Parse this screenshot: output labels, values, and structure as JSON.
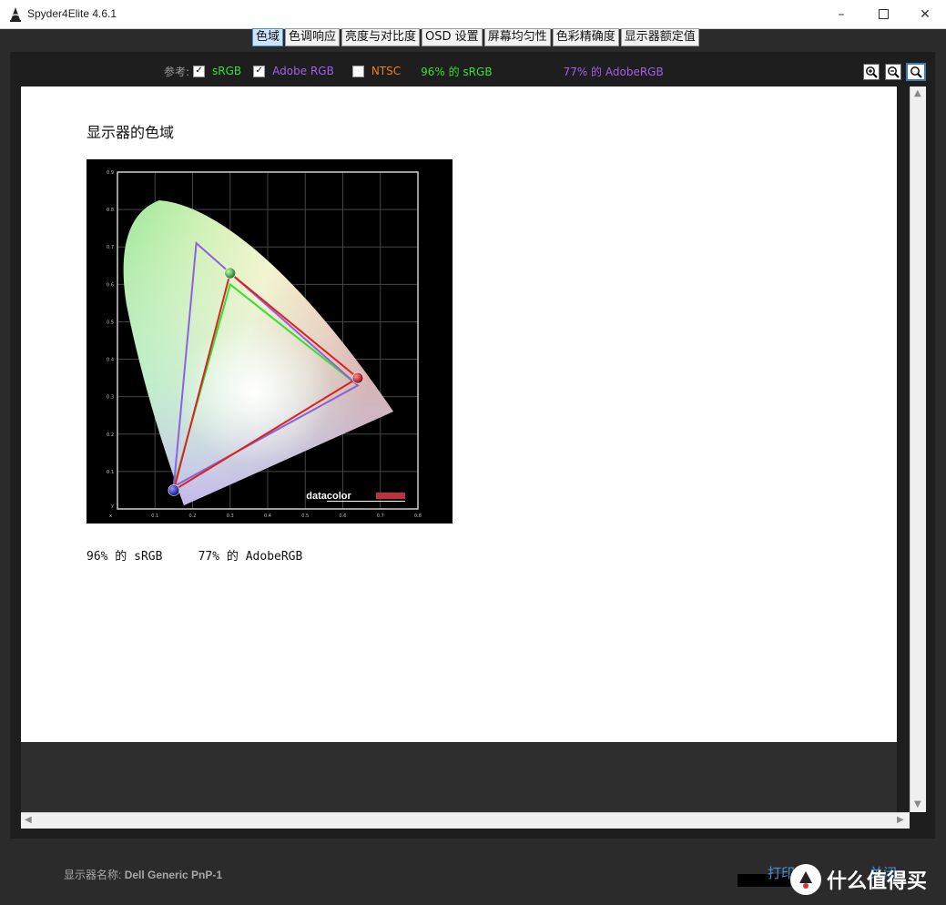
{
  "window": {
    "title": "Spyder4Elite 4.6.1"
  },
  "tabs": [
    {
      "label": "色域",
      "active": true
    },
    {
      "label": "色调响应",
      "active": false
    },
    {
      "label": "亮度与对比度",
      "active": false
    },
    {
      "label": "OSD 设置",
      "active": false
    },
    {
      "label": "屏幕均匀性",
      "active": false
    },
    {
      "label": "色彩精确度",
      "active": false
    },
    {
      "label": "显示器额定值",
      "active": false
    }
  ],
  "reference": {
    "label": "参考:",
    "srgb": {
      "label": "sRGB",
      "checked": true,
      "color": "#35e035"
    },
    "adobe": {
      "label": "Adobe RGB",
      "checked": true,
      "color": "#a060e8"
    },
    "ntsc": {
      "label": "NTSC",
      "checked": false,
      "color": "#f08020"
    },
    "srgb_pct": "96% 的 sRGB",
    "adobe_pct": "77% 的 AdobeRGB"
  },
  "content": {
    "title": "显示器的色域",
    "summary_srgb": "96% 的 sRGB",
    "summary_adobe": "77% 的 AdobeRGB"
  },
  "chart_data": {
    "type": "scatter",
    "x_ticks": [
      "0.1",
      "0.2",
      "0.3",
      "0.4",
      "0.5",
      "0.6",
      "0.7",
      "0.8"
    ],
    "y_ticks": [
      "0.1",
      "0.2",
      "0.3",
      "0.4",
      "0.5",
      "0.6",
      "0.7",
      "0.8",
      "0.9"
    ],
    "xlabel": "x",
    "ylabel": "y",
    "xlim": [
      0,
      0.8
    ],
    "ylim": [
      0,
      0.9
    ],
    "logo": "datacolor",
    "triangles": [
      {
        "points": [
          [
            0.64,
            0.33
          ],
          [
            0.3,
            0.6
          ],
          [
            0.15,
            0.06
          ]
        ],
        "color": "#33e033"
      },
      {
        "points": [
          [
            0.64,
            0.33
          ],
          [
            0.21,
            0.71
          ],
          [
            0.15,
            0.06
          ]
        ],
        "color": "#9060e0"
      },
      {
        "points": [
          [
            0.64,
            0.35
          ],
          [
            0.3,
            0.63
          ],
          [
            0.15,
            0.05
          ]
        ],
        "color": "#e02020"
      }
    ],
    "primaries": [
      {
        "x": 0.64,
        "y": 0.35,
        "color": "#d02020"
      },
      {
        "x": 0.3,
        "y": 0.63,
        "color": "#2aa02a"
      },
      {
        "x": 0.15,
        "y": 0.05,
        "color": "#2020c0"
      }
    ]
  },
  "footer": {
    "monitor_label": "显示器名称:",
    "monitor_name": "Dell Generic PnP-1",
    "print_label": "打印",
    "close_label": "关闭"
  },
  "watermark": {
    "text": "什么值得买"
  }
}
